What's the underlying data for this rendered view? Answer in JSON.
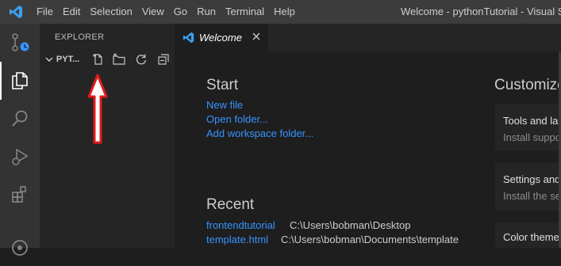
{
  "titlebar": {
    "menu": [
      "File",
      "Edit",
      "Selection",
      "View",
      "Go",
      "Run",
      "Terminal",
      "Help"
    ],
    "window_title": "Welcome - pythonTutorial - Visual Studi"
  },
  "activitybar": {
    "items": [
      "source-control",
      "explorer",
      "search",
      "run-and-debug",
      "extensions",
      "remote"
    ],
    "active": "explorer"
  },
  "sidebar": {
    "header": "EXPLORER",
    "folder_name": "PYT...",
    "toolbar": [
      "new-file",
      "new-folder",
      "refresh",
      "collapse-all"
    ]
  },
  "tab": {
    "label": "Welcome"
  },
  "welcome": {
    "start_heading": "Start",
    "start_links": [
      "New file",
      "Open folder...",
      "Add workspace folder..."
    ],
    "recent_heading": "Recent",
    "recent": [
      {
        "name": "frontendtutorial",
        "path": "C:\\Users\\bobman\\Desktop"
      },
      {
        "name": "template.html",
        "path": "C:\\Users\\bobman\\Documents\\template"
      }
    ],
    "customize_heading": "Customize",
    "cards": [
      {
        "title": "Tools and lan",
        "desc": "Install suppo"
      },
      {
        "title": "Settings and",
        "desc": "Install the se"
      },
      {
        "title": "Color theme",
        "desc": ""
      }
    ]
  },
  "colors": {
    "accent": "#3794ff",
    "annotation_arrow": "#e11b1b",
    "titlebar": "#3c3c3c",
    "activitybar": "#333333",
    "sidebar": "#252526",
    "editor": "#1e1e1e"
  }
}
